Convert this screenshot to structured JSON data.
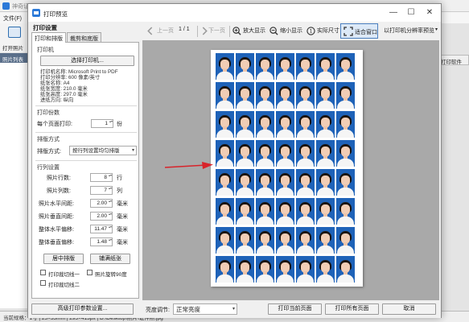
{
  "background_app": {
    "title": "神奇证件照片打印软件",
    "menu_file": "文件(F)",
    "add_photo": "打开照片",
    "photo_list_header": "照片列表",
    "right_button": "打印软件",
    "status_text": "当前规格：1寸 | 25×35mm | 295×413px | D:\\Desktop\\照片\\证件照.jpg"
  },
  "dialog": {
    "title": "打印预览",
    "win_min": "—",
    "win_max": "☐",
    "win_close": "✕"
  },
  "left_panel": {
    "header": "打印设置",
    "tabs": [
      "打印和排版",
      "裁剪和底版"
    ],
    "printer_section": "打印机",
    "select_printer_button": "选择打印机...",
    "printer_info": [
      "打印机名称: Microsoft Print to PDF",
      "打印分辨率: 600 像素/英寸",
      "纸张名称: A4",
      "纸张宽度: 210.0 毫米",
      "纸张高度: 297.0 毫米",
      "进纸方向: 纵向"
    ],
    "copies_section": "打印份数",
    "copies_label": "每个页面打印:",
    "copies_value": "1",
    "copies_unit": "份",
    "layout_section": "排版方式",
    "layout_label": "排版方式:",
    "layout_value": "按行列设置均匀排版",
    "rowcol_section": "行列设置",
    "rows": [
      {
        "label": "照片行数:",
        "value": "8",
        "unit": "行"
      },
      {
        "label": "照片列数:",
        "value": "7",
        "unit": "列"
      },
      {
        "label": "照片水平间距:",
        "value": "2.00",
        "unit": "毫米"
      },
      {
        "label": "照片垂直间距:",
        "value": "2.00",
        "unit": "毫米"
      },
      {
        "label": "整体水平偏移:",
        "value": "11.47",
        "unit": "毫米"
      },
      {
        "label": "整体垂直偏移:",
        "value": "1.48",
        "unit": "毫米"
      }
    ],
    "center_button": "居中排版",
    "fill_button": "铺满纸张",
    "checkboxes": [
      {
        "label": "打印裁切线一",
        "checked": false
      },
      {
        "label": "照片旋转90度",
        "checked": false
      },
      {
        "label": "打印裁切线二",
        "checked": false
      }
    ]
  },
  "toolbar": {
    "prev_page": "上一页",
    "page_indicator": "1 / 1",
    "next_page": "下一页",
    "zoom_in": "放大显示",
    "zoom_out": "缩小显示",
    "actual_size": "实际尺寸",
    "fit_window": "适合窗口",
    "printer_resolution": "以打印机分辨率预览"
  },
  "preview": {
    "rows": 8,
    "columns": 7,
    "background_color": "#1e62b8"
  },
  "bottom_bar": {
    "advanced_button": "高级打印参数设置...",
    "brightness_label": "亮度调节:",
    "brightness_value": "正常亮度",
    "print_current_button": "打印当前页面",
    "print_all_button": "打印所有页面",
    "cancel_button": "取消"
  },
  "colors": {
    "accent": "#2b79d8",
    "photo_background": "#1e62b8",
    "arrow": "#d8232a"
  }
}
